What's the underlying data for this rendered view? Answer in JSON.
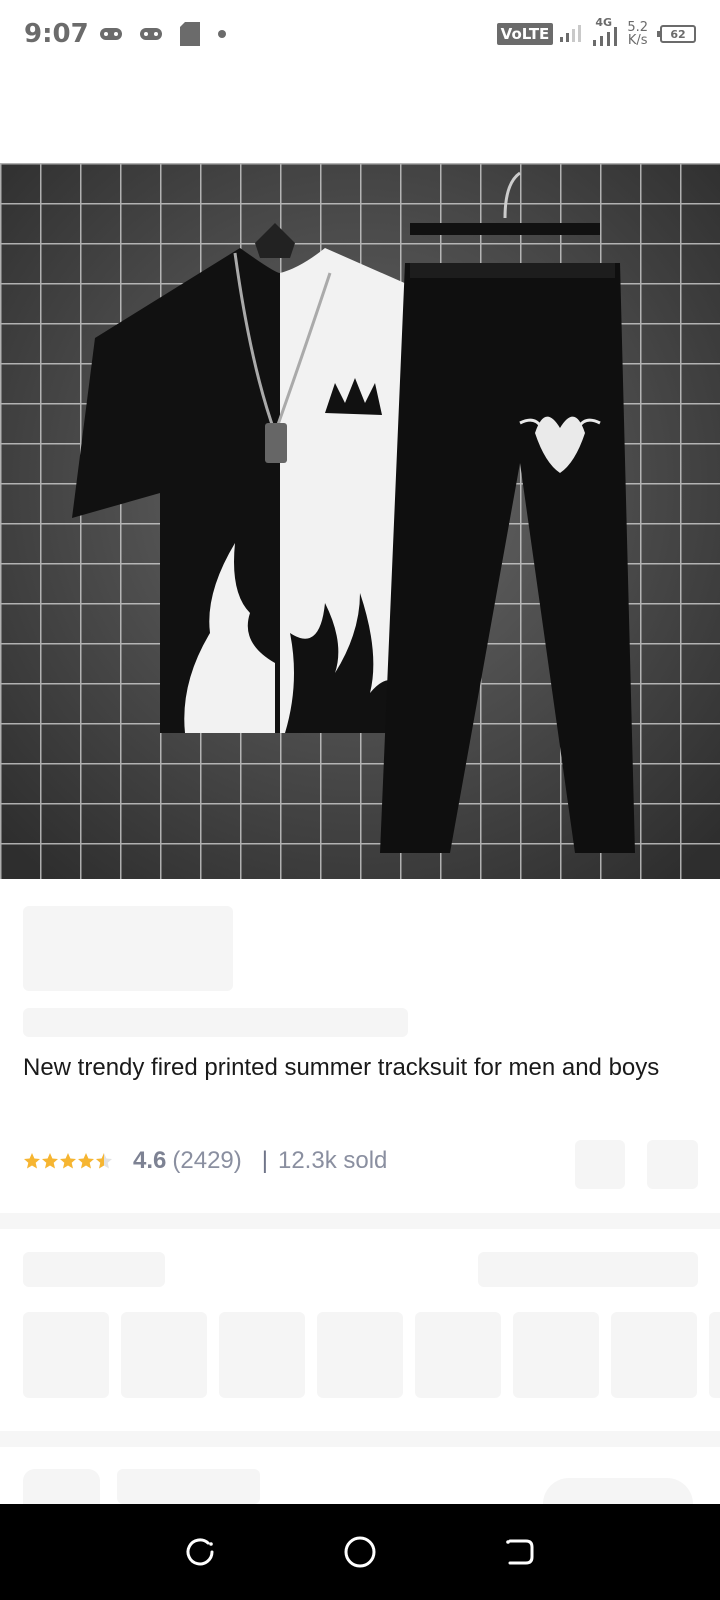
{
  "status_bar": {
    "time": "9:07",
    "network": "VoLTE",
    "net_type": "4G",
    "speed_value": "5.2",
    "speed_unit": "K/s",
    "battery": "62"
  },
  "product": {
    "title": "New trendy fired printed summer tracksuit for men and boys",
    "rating": "4.6",
    "rating_stars": 4.6,
    "review_count": "(2429)",
    "separator": "|",
    "sold": "12.3k sold"
  },
  "nav": {
    "back": "back-nav",
    "home": "home-nav",
    "recents": "recents-nav"
  },
  "colors": {
    "star": "#f6b531",
    "text_dark": "#1a1a1a",
    "text_muted": "#8a8fa0",
    "skeleton": "#f5f5f5"
  }
}
